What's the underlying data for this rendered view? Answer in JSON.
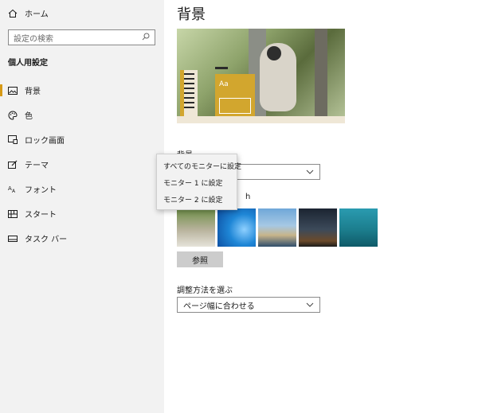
{
  "sidebar": {
    "home_label": "ホーム",
    "search_placeholder": "設定の検索",
    "section_title": "個人用設定",
    "items": [
      {
        "label": "背景",
        "icon": "picture-icon",
        "active": true
      },
      {
        "label": "色",
        "icon": "palette-icon",
        "active": false
      },
      {
        "label": "ロック画面",
        "icon": "lock-screen-icon",
        "active": false
      },
      {
        "label": "テーマ",
        "icon": "theme-icon",
        "active": false
      },
      {
        "label": "フォント",
        "icon": "font-icon",
        "active": false
      },
      {
        "label": "スタート",
        "icon": "start-icon",
        "active": false
      },
      {
        "label": "タスク バー",
        "icon": "taskbar-icon",
        "active": false
      }
    ]
  },
  "main": {
    "title": "背景",
    "preview_sample_text": "Aa",
    "background_label": "背景",
    "background_value": "",
    "choose_label_suffix": "h",
    "browse_label": "参照",
    "fit_label": "調整方法を選ぶ",
    "fit_value": "ページ幅に合わせる"
  },
  "context_menu": {
    "items": [
      "すべてのモニターに設定",
      "モニター 1 に設定",
      "モニター 2 に設定"
    ]
  },
  "colors": {
    "accent": "#d79a17",
    "sidebar_bg": "#f2f2f2",
    "button_bg": "#cccccc"
  }
}
